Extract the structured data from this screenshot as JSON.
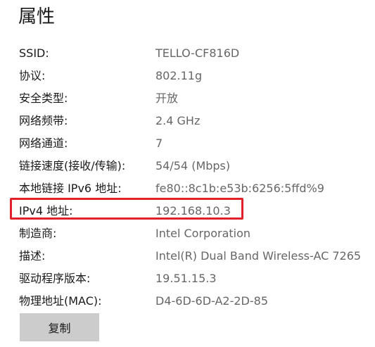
{
  "title": "属性",
  "properties": [
    {
      "label": "SSID:",
      "value": "TELLO-CF816D"
    },
    {
      "label": "协议:",
      "value": "802.11g"
    },
    {
      "label": "安全类型:",
      "value": "开放"
    },
    {
      "label": "网络频带:",
      "value": "2.4 GHz"
    },
    {
      "label": "网络通道:",
      "value": "7"
    },
    {
      "label": "链接速度(接收/传输):",
      "value": "54/54 (Mbps)"
    },
    {
      "label": "本地链接 IPv6 地址:",
      "value": "fe80::8c1b:e53b:6256:5ffd%9"
    },
    {
      "label": "IPv4 地址:",
      "value": "192.168.10.3"
    },
    {
      "label": "制造商:",
      "value": "Intel Corporation"
    },
    {
      "label": "描述:",
      "value": "Intel(R) Dual Band Wireless-AC 7265"
    },
    {
      "label": "驱动程序版本:",
      "value": "19.51.15.3"
    },
    {
      "label": "物理地址(MAC):",
      "value": "D4-6D-6D-A2-2D-85"
    }
  ],
  "copy_button_label": "复制",
  "colors": {
    "highlight": "#e0212b",
    "value_text": "#666666",
    "button_bg": "#cccccc"
  }
}
